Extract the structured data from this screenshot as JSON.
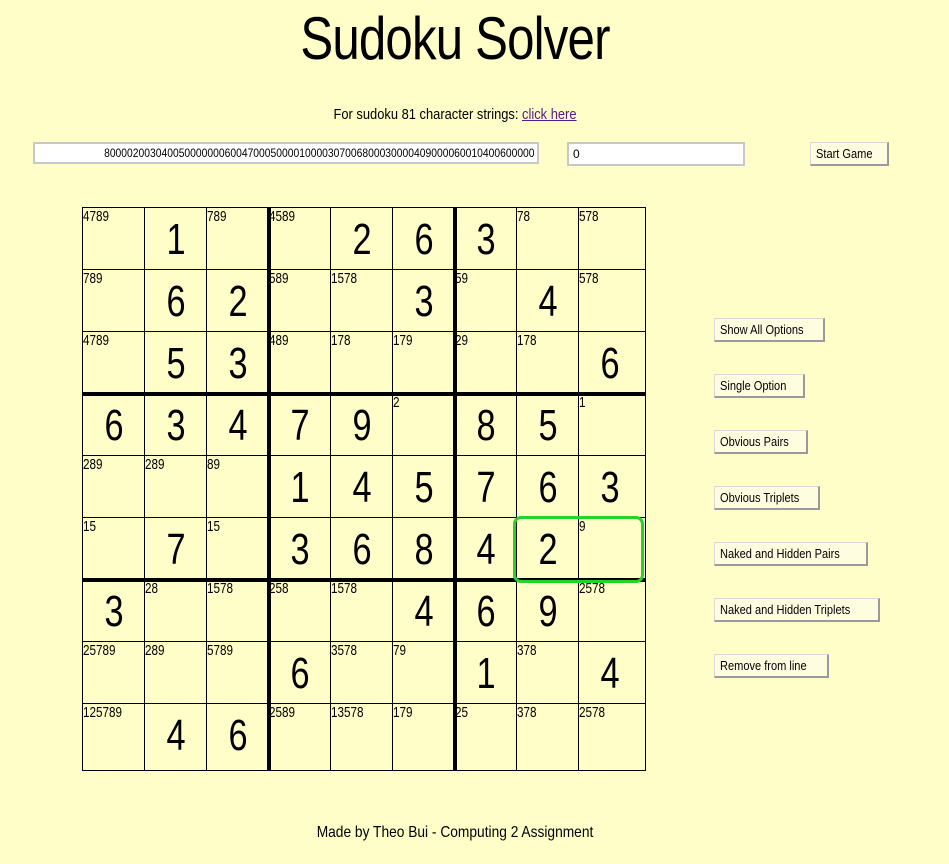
{
  "header": {
    "title": "Sudoku Solver",
    "subtitle_text": "For sudoku 81 character strings: ",
    "subtitle_link": "click here"
  },
  "controls": {
    "puzzle_string": "800002003040050000000600470005000010000307006800030000409000060010400600000",
    "number_value": "0",
    "start_label": "Start Game"
  },
  "solver_buttons": [
    "Show All Options",
    "Single Option",
    "Obvious Pairs",
    "Obvious Triplets",
    "Naked and Hidden Pairs",
    "Naked and Hidden Triplets",
    "Remove from line"
  ],
  "grid": [
    [
      {
        "c": "4789"
      },
      {
        "v": "1"
      },
      {
        "c": "789"
      },
      {
        "c": "4589"
      },
      {
        "v": "2"
      },
      {
        "v": "6"
      },
      {
        "v": "3"
      },
      {
        "c": "78"
      },
      {
        "c": "578"
      }
    ],
    [
      {
        "c": "789"
      },
      {
        "v": "6"
      },
      {
        "v": "2"
      },
      {
        "c": "589"
      },
      {
        "c": "1578"
      },
      {
        "v": "3"
      },
      {
        "c": "59"
      },
      {
        "v": "4"
      },
      {
        "c": "578"
      }
    ],
    [
      {
        "c": "4789"
      },
      {
        "v": "5"
      },
      {
        "v": "3"
      },
      {
        "c": "489"
      },
      {
        "c": "178"
      },
      {
        "c": "179"
      },
      {
        "c": "29"
      },
      {
        "c": "178"
      },
      {
        "v": "6"
      }
    ],
    [
      {
        "v": "6"
      },
      {
        "v": "3"
      },
      {
        "v": "4"
      },
      {
        "v": "7"
      },
      {
        "v": "9"
      },
      {
        "c": "2"
      },
      {
        "v": "8"
      },
      {
        "v": "5"
      },
      {
        "c": "1"
      }
    ],
    [
      {
        "c": "289"
      },
      {
        "c": "289"
      },
      {
        "c": "89"
      },
      {
        "v": "1"
      },
      {
        "v": "4"
      },
      {
        "v": "5"
      },
      {
        "v": "7"
      },
      {
        "v": "6"
      },
      {
        "v": "3"
      }
    ],
    [
      {
        "c": "15"
      },
      {
        "v": "7"
      },
      {
        "c": "15"
      },
      {
        "v": "3"
      },
      {
        "v": "6"
      },
      {
        "v": "8"
      },
      {
        "v": "4"
      },
      {
        "v": "2"
      },
      {
        "c": "9"
      }
    ],
    [
      {
        "v": "3"
      },
      {
        "c": "28"
      },
      {
        "c": "1578"
      },
      {
        "c": "258"
      },
      {
        "c": "1578"
      },
      {
        "v": "4"
      },
      {
        "v": "6"
      },
      {
        "v": "9"
      },
      {
        "c": "2578"
      }
    ],
    [
      {
        "c": "25789"
      },
      {
        "c": "289"
      },
      {
        "c": "5789"
      },
      {
        "v": "6"
      },
      {
        "c": "3578"
      },
      {
        "c": "79"
      },
      {
        "v": "1"
      },
      {
        "c": "378"
      },
      {
        "v": "4"
      }
    ],
    [
      {
        "c": "125789"
      },
      {
        "v": "4"
      },
      {
        "v": "6"
      },
      {
        "c": "2589"
      },
      {
        "c": "13578"
      },
      {
        "c": "179"
      },
      {
        "c": "25"
      },
      {
        "c": "378"
      },
      {
        "c": "2578"
      }
    ]
  ],
  "colors": {
    "background": "#fffdc8",
    "highlight": "#29d12b",
    "link": "#551a8b"
  },
  "footer": {
    "text": "Made by Theo Bui - Computing 2 Assignment"
  }
}
